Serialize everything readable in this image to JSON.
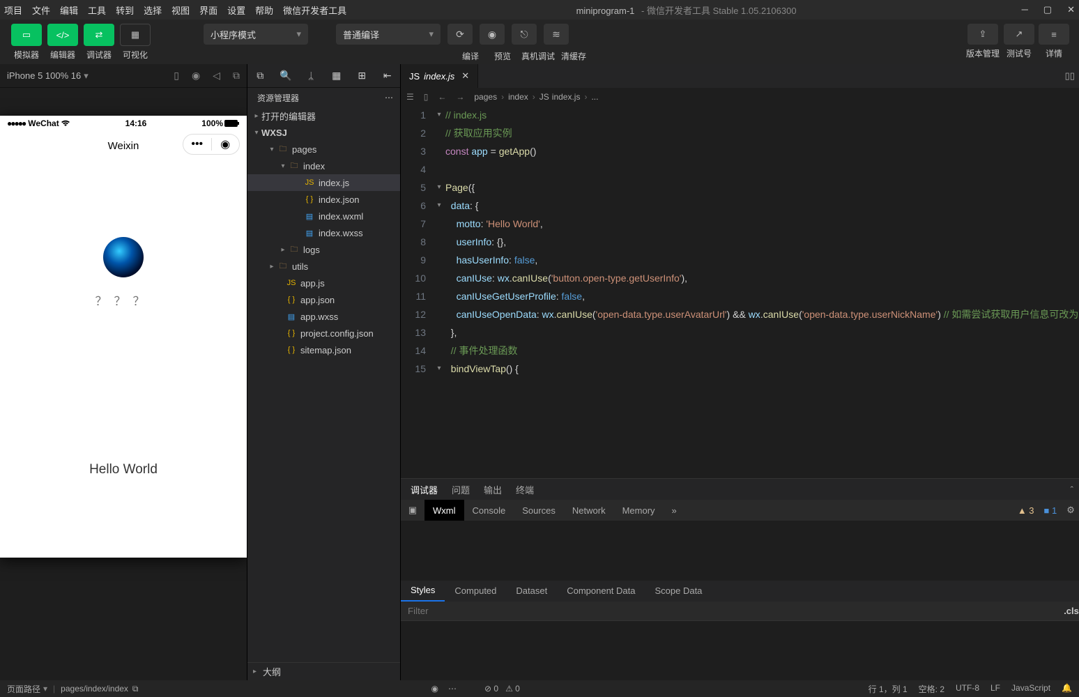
{
  "menu": {
    "items": [
      "项目",
      "文件",
      "编辑",
      "工具",
      "转到",
      "选择",
      "视图",
      "界面",
      "设置",
      "帮助",
      "微信开发者工具"
    ]
  },
  "title": {
    "name": "miniprogram-1",
    "suffix": " - 微信开发者工具 Stable 1.05.2106300"
  },
  "toolbar": {
    "groupA": [
      "模拟器",
      "编辑器",
      "调试器"
    ],
    "visualize": "可视化",
    "modeSel": "小程序模式",
    "compileSel": "普通编译",
    "midBtns": [
      "编译",
      "预览",
      "真机调试",
      "清缓存"
    ],
    "rightBtns": [
      "版本管理",
      "测试号",
      "详情"
    ]
  },
  "sim": {
    "device": "iPhone 5 100% 16",
    "statusCarrier": "WeChat",
    "statusTime": "14:16",
    "statusBattery": "100%",
    "navTitle": "Weixin",
    "questionMarks": "？？？",
    "hello": "Hello World"
  },
  "explorer": {
    "title": "资源管理器",
    "openEditors": "打开的编辑器",
    "project": "WXSJ",
    "tree": [
      {
        "pad": 28,
        "arrow": "▾",
        "icon": "folder",
        "name": "pages"
      },
      {
        "pad": 44,
        "arrow": "▾",
        "icon": "folder",
        "name": "index"
      },
      {
        "pad": 66,
        "arrow": "",
        "icon": "js",
        "name": "index.js",
        "sel": true
      },
      {
        "pad": 66,
        "arrow": "",
        "icon": "json",
        "name": "index.json"
      },
      {
        "pad": 66,
        "arrow": "",
        "icon": "wxml",
        "name": "index.wxml"
      },
      {
        "pad": 66,
        "arrow": "",
        "icon": "wxss",
        "name": "index.wxss"
      },
      {
        "pad": 44,
        "arrow": "▸",
        "icon": "folder",
        "name": "logs"
      },
      {
        "pad": 28,
        "arrow": "▸",
        "icon": "folder",
        "name": "utils"
      },
      {
        "pad": 40,
        "arrow": "",
        "icon": "js",
        "name": "app.js"
      },
      {
        "pad": 40,
        "arrow": "",
        "icon": "json",
        "name": "app.json"
      },
      {
        "pad": 40,
        "arrow": "",
        "icon": "wxss",
        "name": "app.wxss"
      },
      {
        "pad": 40,
        "arrow": "",
        "icon": "json",
        "name": "project.config.json"
      },
      {
        "pad": 40,
        "arrow": "",
        "icon": "json",
        "name": "sitemap.json"
      }
    ],
    "outline": "大纲"
  },
  "editor": {
    "tabName": "index.js",
    "crumbs": [
      "pages",
      "index",
      "index.js",
      "..."
    ],
    "lines": [
      {
        "n": 1,
        "fold": "▾",
        "html": "<span class='c-comment'>// index.js</span>"
      },
      {
        "n": 2,
        "fold": "",
        "html": "<span class='c-comment'>// 获取应用实例</span>"
      },
      {
        "n": 3,
        "fold": "",
        "html": "<span class='c-kw'>const</span> <span class='c-ident'>app</span> <span class='c-op'>=</span> <span class='c-call'>getApp</span>()"
      },
      {
        "n": 4,
        "fold": "",
        "html": ""
      },
      {
        "n": 5,
        "fold": "▾",
        "html": "<span class='c-call'>Page</span>({"
      },
      {
        "n": 6,
        "fold": "▾",
        "html": "  <span class='c-prop'>data</span>: {"
      },
      {
        "n": 7,
        "fold": "",
        "html": "    <span class='c-prop'>motto</span>: <span class='c-str'>'Hello World'</span>,"
      },
      {
        "n": 8,
        "fold": "",
        "html": "    <span class='c-prop'>userInfo</span>: {},"
      },
      {
        "n": 9,
        "fold": "",
        "html": "    <span class='c-prop'>hasUserInfo</span>: <span class='c-bool'>false</span>,"
      },
      {
        "n": 10,
        "fold": "",
        "html": "    <span class='c-prop'>canIUse</span>: <span class='c-ident'>wx</span>.<span class='c-call'>canIUse</span>(<span class='c-str'>'button.open-type.getUserInfo'</span>),"
      },
      {
        "n": 11,
        "fold": "",
        "html": "    <span class='c-prop'>canIUseGetUserProfile</span>: <span class='c-bool'>false</span>,"
      },
      {
        "n": 12,
        "fold": "",
        "html": "    <span class='c-prop'>canIUseOpenData</span>: <span class='c-ident'>wx</span>.<span class='c-call'>canIUse</span>(<span class='c-str'>'open-data.type.userAvatarUrl'</span>) <span class='c-op'>&amp;&amp;</span> <span class='c-ident'>wx</span>.<span class='c-call'>canIUse</span>(<span class='c-str'>'open-data.type.userNickName'</span>) <span class='c-comment'>// 如需尝试获取用户信息可改为</span> <span class='c-bool'>false</span>"
      },
      {
        "n": 13,
        "fold": "",
        "html": "  },"
      },
      {
        "n": 14,
        "fold": "",
        "html": "  <span class='c-comment'>// 事件处理函数</span>"
      },
      {
        "n": 15,
        "fold": "▾",
        "html": "  <span class='c-call'>bindViewTap</span>() {"
      }
    ]
  },
  "debugger": {
    "topTabs": [
      "调试器",
      "问题",
      "输出",
      "终端"
    ],
    "devtabs": [
      "Wxml",
      "Console",
      "Sources",
      "Network",
      "Memory"
    ],
    "warnCount": "3",
    "infoCount": "1",
    "styleTabs": [
      "Styles",
      "Computed",
      "Dataset",
      "Component Data",
      "Scope Data"
    ],
    "filterPlaceholder": "Filter",
    "cls": ".cls"
  },
  "status": {
    "left": "页面路径",
    "path": "pages/index/index",
    "right": [
      "行 1，列 1",
      "空格: 2",
      "UTF-8",
      "LF",
      "JavaScript"
    ],
    "errs": "0",
    "warns": "0"
  }
}
